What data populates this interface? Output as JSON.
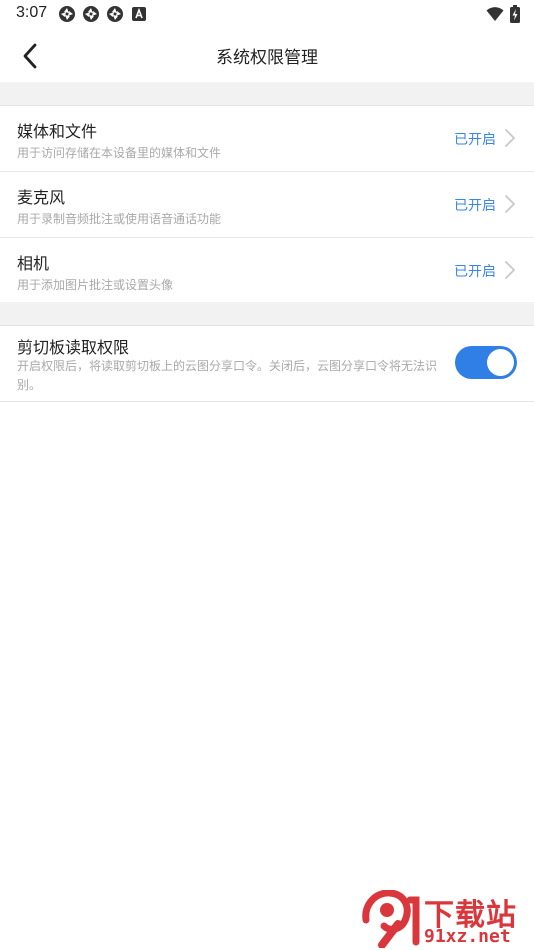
{
  "status_bar": {
    "time": "3:07",
    "left_icons": [
      "notification-icon",
      "notification-icon",
      "notification-icon",
      "app-a-icon"
    ],
    "right_icons": [
      "wifi-icon",
      "battery-charging-icon"
    ]
  },
  "nav": {
    "title": "系统权限管理",
    "back_icon": "chevron-left-icon"
  },
  "permissions": [
    {
      "title": "媒体和文件",
      "desc": "用于访问存储在本设备里的媒体和文件",
      "status": "已开启"
    },
    {
      "title": "麦克风",
      "desc": "用于录制音频批注或使用语音通话功能",
      "status": "已开启"
    },
    {
      "title": "相机",
      "desc": "用于添加图片批注或设置头像",
      "status": "已开启"
    }
  ],
  "clipboard": {
    "title": "剪切板读取权限",
    "desc": "开启权限后，将读取剪切板上的云图分享口令。关闭后，云图分享口令将无法识别。",
    "enabled": true
  },
  "watermark": {
    "logo_text": "9",
    "top": "下载站",
    "bottom": "91xz.net"
  },
  "colors": {
    "accent": "#2f7fe6",
    "status_text": "#3a86e8",
    "watermark": "#d9373c",
    "background_band": "#f2f2f2"
  }
}
